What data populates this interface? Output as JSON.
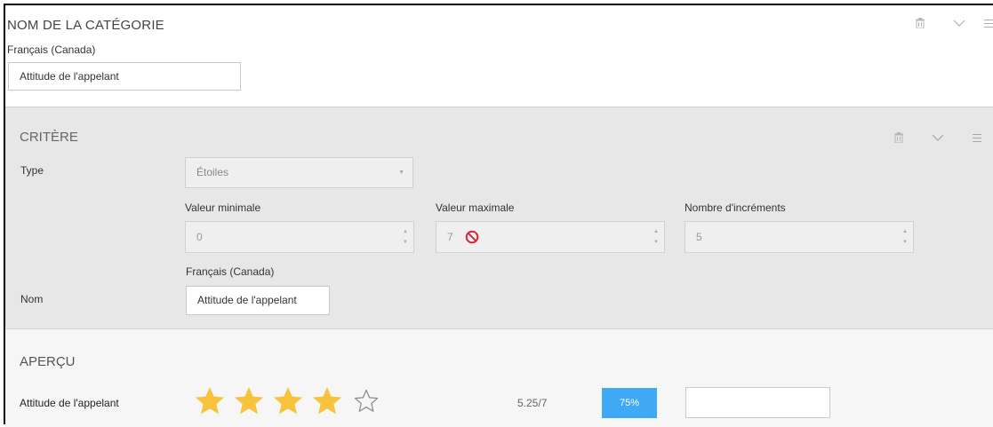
{
  "category": {
    "title": "NOM DE LA CATÉGORIE",
    "language": "Français (Canada)",
    "name_value": "Attitude de l'appelant",
    "icons": [
      "trash-icon",
      "chevron-down-icon",
      "menu-icon"
    ]
  },
  "criterion": {
    "title": "CRITÈRE",
    "icons": [
      "trash-icon",
      "chevron-down-icon",
      "menu-icon"
    ],
    "type_label": "Type",
    "type_value": "Étoiles",
    "min_label": "Valeur minimale",
    "min_value": "0",
    "max_label": "Valeur maximale",
    "max_value": "7",
    "increments_label": "Nombre d'incréments",
    "increments_value": "5",
    "name_label": "Nom",
    "name_language": "Français (Canada)",
    "name_value": "Attitude de l'appelant"
  },
  "preview": {
    "title": "APERÇU",
    "item_label": "Attitude de l'appelant",
    "rating": {
      "filled": 4,
      "total": 5
    },
    "score": "5.25/7",
    "percent": "75%",
    "comment_value": "",
    "colors": {
      "star": "#f9c23c",
      "badge": "#3fa9f5",
      "badge_text": "#ffffff"
    }
  }
}
